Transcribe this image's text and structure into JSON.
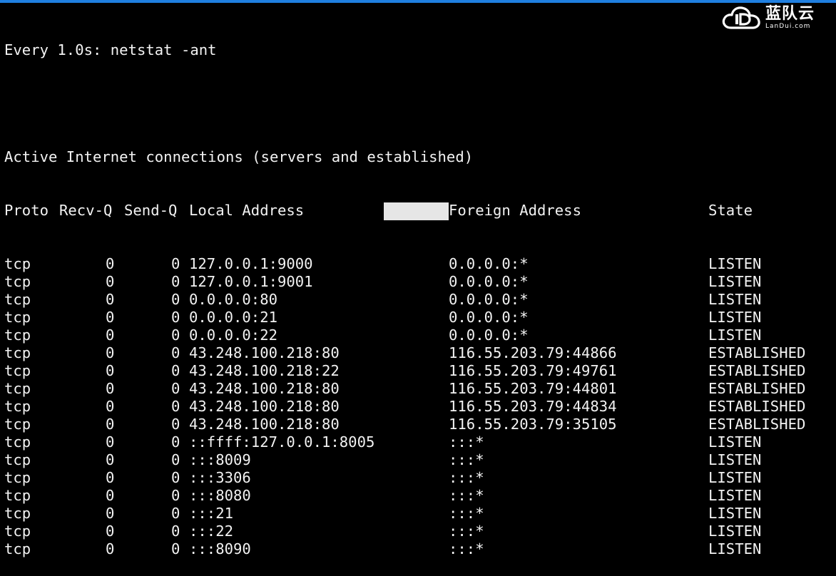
{
  "command_line": "Every 1.0s: netstat -ant",
  "heading": "Active Internet connections (servers and established)",
  "columns": {
    "proto": "Proto",
    "recv_q": "Recv-Q",
    "send_q": "Send-Q",
    "local": "Local Address",
    "foreign": "Foreign Address",
    "state": "State"
  },
  "rows": [
    {
      "proto": "tcp",
      "recv": "0",
      "send": "0",
      "local": "127.0.0.1:9000",
      "foreign": "0.0.0.0:*",
      "state": "LISTEN"
    },
    {
      "proto": "tcp",
      "recv": "0",
      "send": "0",
      "local": "127.0.0.1:9001",
      "foreign": "0.0.0.0:*",
      "state": "LISTEN"
    },
    {
      "proto": "tcp",
      "recv": "0",
      "send": "0",
      "local": "0.0.0.0:80",
      "foreign": "0.0.0.0:*",
      "state": "LISTEN"
    },
    {
      "proto": "tcp",
      "recv": "0",
      "send": "0",
      "local": "0.0.0.0:21",
      "foreign": "0.0.0.0:*",
      "state": "LISTEN"
    },
    {
      "proto": "tcp",
      "recv": "0",
      "send": "0",
      "local": "0.0.0.0:22",
      "foreign": "0.0.0.0:*",
      "state": "LISTEN"
    },
    {
      "proto": "tcp",
      "recv": "0",
      "send": "0",
      "local": "43.248.100.218:80",
      "foreign": "116.55.203.79:44866",
      "state": "ESTABLISHED"
    },
    {
      "proto": "tcp",
      "recv": "0",
      "send": "0",
      "local": "43.248.100.218:22",
      "foreign": "116.55.203.79:49761",
      "state": "ESTABLISHED"
    },
    {
      "proto": "tcp",
      "recv": "0",
      "send": "0",
      "local": "43.248.100.218:80",
      "foreign": "116.55.203.79:44801",
      "state": "ESTABLISHED"
    },
    {
      "proto": "tcp",
      "recv": "0",
      "send": "0",
      "local": "43.248.100.218:80",
      "foreign": "116.55.203.79:44834",
      "state": "ESTABLISHED"
    },
    {
      "proto": "tcp",
      "recv": "0",
      "send": "0",
      "local": "43.248.100.218:80",
      "foreign": "116.55.203.79:35105",
      "state": "ESTABLISHED"
    },
    {
      "proto": "tcp",
      "recv": "0",
      "send": "0",
      "local": "::ffff:127.0.0.1:8005",
      "foreign": ":::*",
      "state": "LISTEN"
    },
    {
      "proto": "tcp",
      "recv": "0",
      "send": "0",
      "local": ":::8009",
      "foreign": ":::*",
      "state": "LISTEN"
    },
    {
      "proto": "tcp",
      "recv": "0",
      "send": "0",
      "local": ":::3306",
      "foreign": ":::*",
      "state": "LISTEN"
    },
    {
      "proto": "tcp",
      "recv": "0",
      "send": "0",
      "local": ":::8080",
      "foreign": ":::*",
      "state": "LISTEN"
    },
    {
      "proto": "tcp",
      "recv": "0",
      "send": "0",
      "local": ":::21",
      "foreign": ":::*",
      "state": "LISTEN"
    },
    {
      "proto": "tcp",
      "recv": "0",
      "send": "0",
      "local": ":::22",
      "foreign": ":::*",
      "state": "LISTEN"
    },
    {
      "proto": "tcp",
      "recv": "0",
      "send": "0",
      "local": ":::8090",
      "foreign": ":::*",
      "state": "LISTEN"
    }
  ],
  "watermark": {
    "icon": "cloud-logo-icon",
    "name_cn": "蓝队云",
    "name_en": "LanDui.com"
  },
  "colors": {
    "background": "#000000",
    "text": "#f2f2f2",
    "accent_bar": "#1f7fe0",
    "redaction": "#e6e6e6"
  }
}
